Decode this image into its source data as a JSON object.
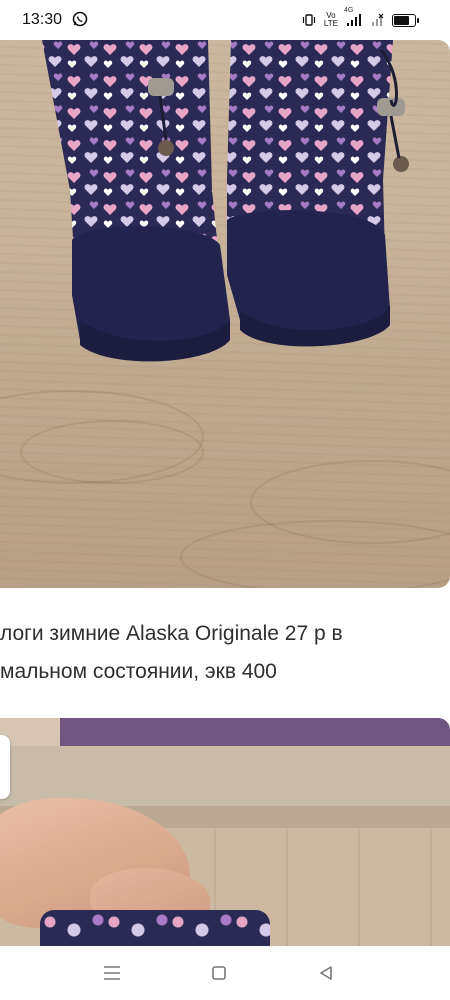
{
  "status_bar": {
    "time": "13:30",
    "network_top": "Vo",
    "network_bottom": "LTE",
    "signal_label": "4G",
    "icons": [
      "whatsapp-icon",
      "vibrate-icon",
      "volte-icon",
      "signal-icon",
      "battery-icon"
    ]
  },
  "listing": {
    "caption_line1": "логи зимние Alaska Originale 27 р в",
    "caption_line2": "мальном состоянии, экв 400"
  },
  "nav": {
    "icons": [
      "menu-icon",
      "home-icon",
      "back-icon"
    ]
  },
  "colors": {
    "boot_navy": "#2b2a55",
    "boot_pink": "#e7a5c8",
    "boot_purple": "#a77cc7",
    "floor": "#c8b29a",
    "wall_purple": "#6f5683"
  }
}
